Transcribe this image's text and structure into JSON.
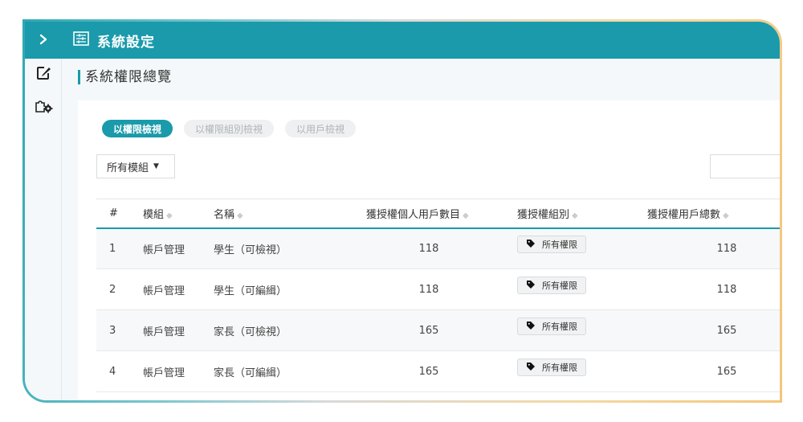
{
  "sidebar": {
    "toggle_icon": "chevron-right-icon",
    "items": [
      {
        "icon": "edit-icon"
      },
      {
        "icon": "puzzle-gear-icon"
      }
    ]
  },
  "header": {
    "icon": "settings-sliders-icon",
    "title": "系統設定"
  },
  "page": {
    "section_title": "系統權限總覽"
  },
  "tabs": [
    {
      "label": "以權限檢視",
      "active": true
    },
    {
      "label": "以權限組別檢視",
      "active": false
    },
    {
      "label": "以用戶檢視",
      "active": false
    }
  ],
  "filter": {
    "module_value": "所有模組"
  },
  "table": {
    "columns": [
      "#",
      "模組",
      "名稱",
      "獲授權個人用戶數目",
      "獲授權組別",
      "獲授權用戶總數"
    ],
    "rows": [
      {
        "no": "1",
        "module": "帳戶管理",
        "name": "學生（可檢視）",
        "personal": "118",
        "group": "所有權限",
        "total": "118"
      },
      {
        "no": "2",
        "module": "帳戶管理",
        "name": "學生（可編緝）",
        "personal": "118",
        "group": "所有權限",
        "total": "118"
      },
      {
        "no": "3",
        "module": "帳戶管理",
        "name": "家長（可檢視）",
        "personal": "165",
        "group": "所有權限",
        "total": "165"
      },
      {
        "no": "4",
        "module": "帳戶管理",
        "name": "家長（可編緝）",
        "personal": "165",
        "group": "所有權限",
        "total": "165"
      }
    ]
  },
  "colors": {
    "accent": "#1a9aaa",
    "background": "#f4f8fa"
  }
}
